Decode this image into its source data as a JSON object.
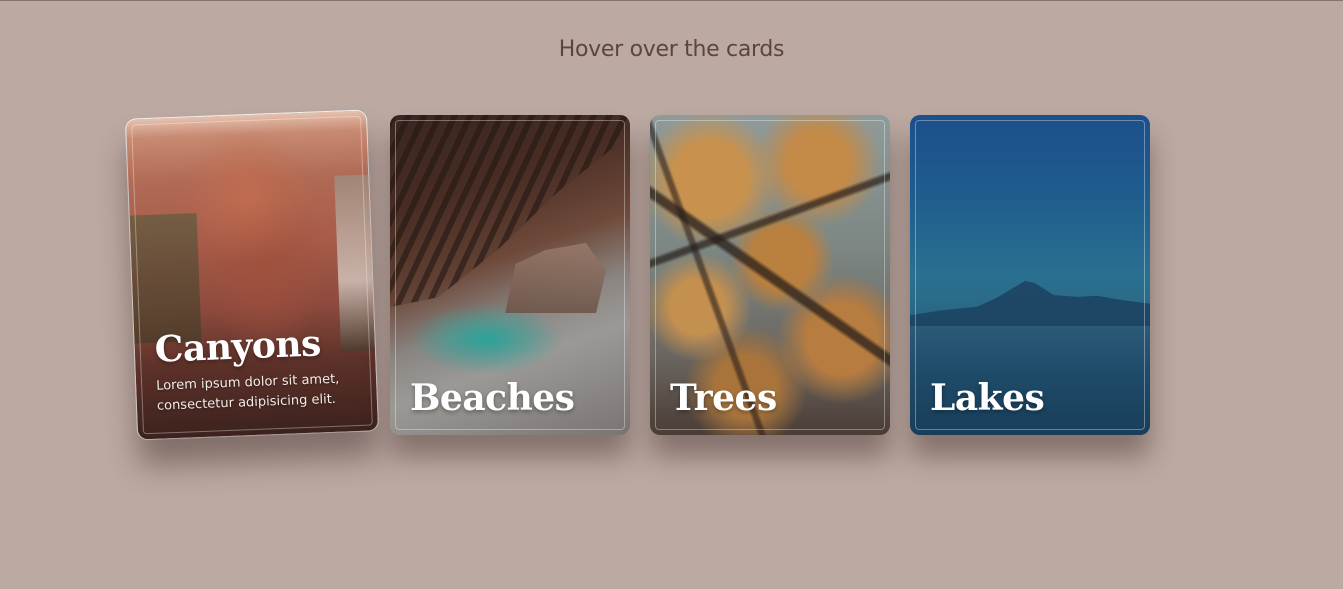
{
  "heading": "Hover over the cards",
  "cards": [
    {
      "title": "Canyons",
      "description": "Lorem ipsum dolor sit amet, consectetur adipisicing elit.",
      "state": "hovered"
    },
    {
      "title": "Beaches"
    },
    {
      "title": "Trees"
    },
    {
      "title": "Lakes"
    }
  ],
  "colors": {
    "background": "#bba9a2",
    "heading": "#5e4440",
    "card_text": "#ffffff"
  }
}
